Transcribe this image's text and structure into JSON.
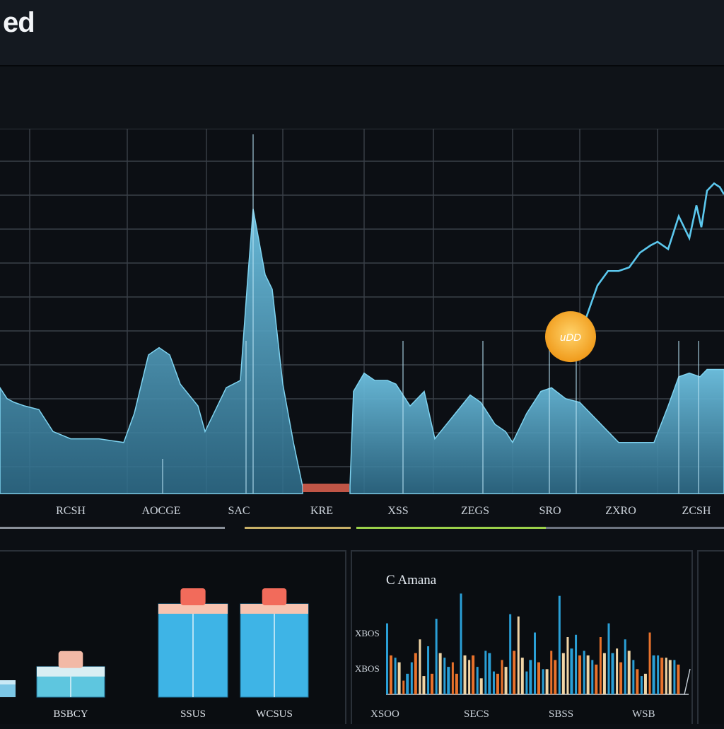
{
  "header": {
    "title": "ed"
  },
  "chart_data": [
    {
      "type": "area",
      "series": [
        {
          "values": [
            [
              0,
              29
            ],
            [
              10,
              26
            ],
            [
              20,
              25
            ],
            [
              35,
              24
            ],
            [
              55,
              23
            ],
            [
              75,
              17
            ],
            [
              100,
              15
            ],
            [
              140,
              15
            ],
            [
              175,
              14
            ],
            [
              190,
              22
            ],
            [
              210,
              38
            ],
            [
              225,
              40
            ],
            [
              240,
              38
            ],
            [
              255,
              30
            ],
            [
              280,
              24
            ],
            [
              290,
              17
            ],
            [
              305,
              23
            ],
            [
              320,
              29
            ],
            [
              340,
              31
            ],
            [
              350,
              58
            ],
            [
              358,
              78
            ],
            [
              375,
              60
            ],
            [
              385,
              56
            ],
            [
              400,
              30
            ],
            [
              415,
              14
            ],
            [
              428,
              2
            ],
            [
              495,
              2
            ],
            [
              500,
              28
            ],
            [
              515,
              33
            ],
            [
              530,
              31
            ],
            [
              548,
              31
            ],
            [
              560,
              30
            ],
            [
              570,
              27
            ],
            [
              580,
              24
            ],
            [
              590,
              26
            ],
            [
              600,
              28
            ],
            [
              615,
              15
            ],
            [
              640,
              21
            ],
            [
              665,
              27
            ],
            [
              680,
              25
            ],
            [
              700,
              19
            ],
            [
              715,
              17
            ],
            [
              725,
              14
            ],
            [
              745,
              22
            ],
            [
              765,
              28
            ],
            [
              780,
              29
            ],
            [
              800,
              26
            ],
            [
              820,
              25
            ],
            [
              845,
              20
            ],
            [
              875,
              14
            ],
            [
              925,
              14
            ],
            [
              945,
              24
            ],
            [
              960,
              32
            ],
            [
              975,
              33
            ],
            [
              990,
              32
            ],
            [
              1000,
              34
            ],
            [
              1024,
              34
            ]
          ]
        },
        {
          "values": [
            [
              825,
              46
            ],
            [
              845,
              57
            ],
            [
              860,
              61
            ],
            [
              875,
              61
            ],
            [
              890,
              62
            ],
            [
              905,
              66
            ],
            [
              920,
              68
            ],
            [
              930,
              69
            ],
            [
              945,
              67
            ],
            [
              960,
              76
            ],
            [
              970,
              72
            ],
            [
              975,
              70
            ],
            [
              985,
              79
            ],
            [
              992,
              73
            ],
            [
              1000,
              83
            ],
            [
              1010,
              85
            ],
            [
              1018,
              84
            ],
            [
              1024,
              82
            ]
          ]
        }
      ],
      "xticks": [
        "RCSH",
        "AOCGE",
        "SAC",
        "KRE",
        "XSS",
        "ZEGS",
        "SRO",
        "ZXRO",
        "ZCSH"
      ],
      "ylim": [
        0,
        100
      ],
      "grid": true,
      "annotation": {
        "label": "uDD",
        "x": 807,
        "y": 43
      }
    },
    {
      "type": "bar",
      "categories": [
        "BSBCY",
        "SSUS",
        "WCSUS"
      ],
      "values": [
        18,
        55,
        55
      ],
      "ylim": [
        0,
        100
      ]
    },
    {
      "type": "bar",
      "title": "C Amana",
      "yticks": [
        "XBOS",
        "XBOS"
      ],
      "xticks": [
        "XSOO",
        "SECS",
        "SBSS",
        "WSB"
      ],
      "series": [
        {
          "name": "",
          "values": [
            62,
            32,
            12,
            28,
            48,
            42,
            66,
            32,
            28,
            88,
            30,
            24,
            38,
            20,
            30,
            70,
            68,
            20,
            54,
            22,
            38,
            86,
            50,
            52,
            38,
            30,
            50,
            62,
            40,
            48,
            30,
            16,
            54,
            34,
            32,
            30
          ]
        },
        {
          "name": "",
          "values": [
            34,
            28,
            18,
            36,
            16,
            18,
            36,
            24,
            18,
            34,
            34,
            14,
            36,
            18,
            24,
            38,
            32,
            30,
            28,
            22,
            30,
            36,
            40,
            34,
            34,
            26,
            36,
            36,
            28,
            38,
            22,
            18,
            34,
            32,
            30,
            26
          ]
        }
      ],
      "ylim": [
        0,
        100
      ]
    }
  ],
  "colors": {
    "background": "#0c0f14",
    "area_fill": "#4aa3c8",
    "line": "#5cc8ee",
    "marker": "#f4a623",
    "bar_blue": "#2a9fd6",
    "bar_orange": "#e8722c",
    "bar_cream": "#f0d5a6",
    "box_blue": "#3eb4e6",
    "box_red": "#f26b5b"
  }
}
